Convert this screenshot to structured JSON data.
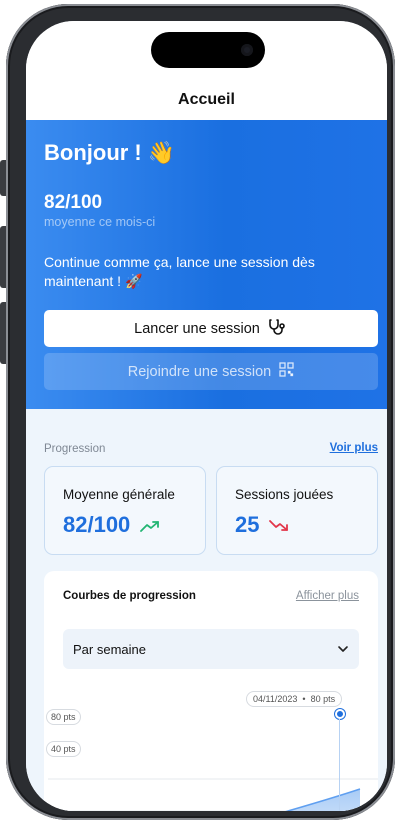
{
  "nav": {
    "title": "Accueil"
  },
  "hero": {
    "greeting": "Bonjour ! 👋",
    "score": "82/100",
    "score_caption": "moyenne ce mois-ci",
    "encouragement": "Continue comme ça, lance une session dès maintenant ! 🚀",
    "primary_button": "Lancer une session",
    "secondary_button": "Rejoindre une session"
  },
  "progress": {
    "section_label": "Progression",
    "see_more": "Voir plus",
    "cards": [
      {
        "label": "Moyenne générale",
        "value": "82/100",
        "trend": "up"
      },
      {
        "label": "Sessions jouées",
        "value": "25",
        "trend": "down"
      }
    ]
  },
  "curves": {
    "title": "Courbes de progression",
    "show_more": "Afficher plus",
    "period_select": "Par semaine"
  },
  "chart_data": {
    "type": "area",
    "tick_labels": [
      "80 pts",
      "40 pts"
    ],
    "tooltip": {
      "date": "04/11/2023",
      "value": "80 pts"
    },
    "color": "#1f6fdd"
  },
  "colors": {
    "accent": "#1f6fdd",
    "up": "#22b573",
    "down": "#e2364a"
  }
}
